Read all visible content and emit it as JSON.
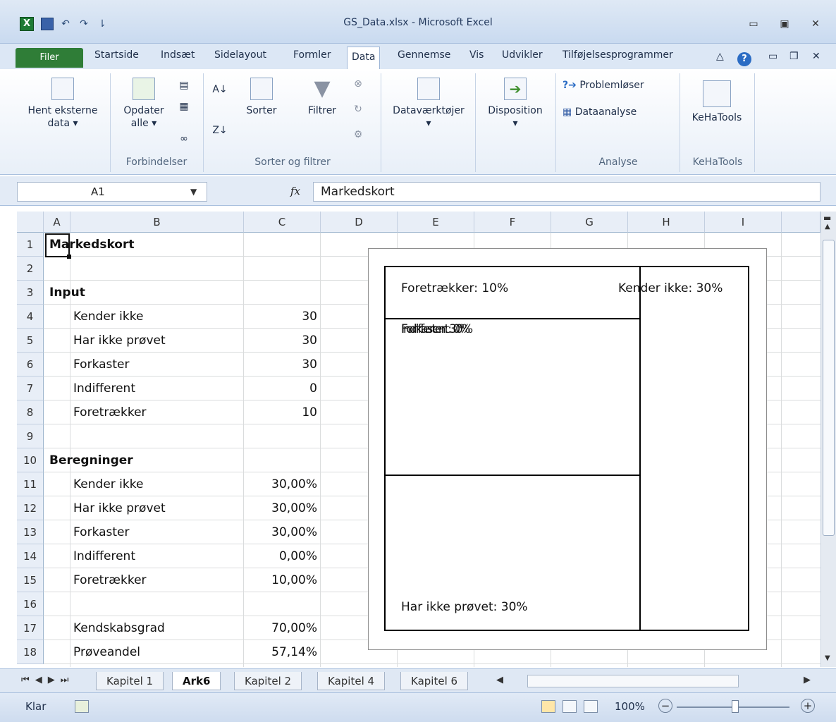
{
  "window": {
    "title": "GS_Data.xlsx - Microsoft Excel",
    "app_icon": "X",
    "qat_icons": [
      "save-icon",
      "undo-icon",
      "redo-icon",
      "customize-icon"
    ]
  },
  "ribbon_tabs": [
    {
      "label": "Filer"
    },
    {
      "label": "Startside"
    },
    {
      "label": "Indsæt"
    },
    {
      "label": "Sidelayout"
    },
    {
      "label": "Formler"
    },
    {
      "label": "Data"
    },
    {
      "label": "Gennemse"
    },
    {
      "label": "Vis"
    },
    {
      "label": "Udvikler"
    },
    {
      "label": "Tilføjelsesprogrammer"
    }
  ],
  "ribbon": {
    "get_external": {
      "line1": "Hent eksterne",
      "line2": "data ▾"
    },
    "refresh": {
      "line1": "Opdater",
      "line2": "alle ▾"
    },
    "sort": "Sorter",
    "filter": "Filtrer",
    "data_tools": "Dataværktøjer",
    "outline": "Disposition",
    "solver": "Problemløser",
    "data_analysis": "Dataanalyse",
    "kehatools": "KeHaTools",
    "groups": {
      "connections": "Forbindelser",
      "sort_filter": "Sorter og filtrer",
      "analysis": "Analyse",
      "kehatools": "KeHaTools"
    }
  },
  "formula_bar": {
    "name_box": "A1",
    "fx": "fx",
    "formula": "Markedskort"
  },
  "columns": [
    "A",
    "B",
    "C",
    "D",
    "E",
    "F",
    "G",
    "H",
    "I"
  ],
  "rows": [
    "1",
    "2",
    "3",
    "4",
    "5",
    "6",
    "7",
    "8",
    "9",
    "10",
    "11",
    "12",
    "13",
    "14",
    "15",
    "16",
    "17",
    "18"
  ],
  "cells": {
    "r1": {
      "label": "Markedskort"
    },
    "r3": {
      "label": "Input"
    },
    "r4": {
      "label": "Kender ikke",
      "value": "30"
    },
    "r5": {
      "label": "Har ikke prøvet",
      "value": "30"
    },
    "r6": {
      "label": "Forkaster",
      "value": "30"
    },
    "r7": {
      "label": "Indifferent",
      "value": "0"
    },
    "r8": {
      "label": "Foretrækker",
      "value": "10"
    },
    "r10": {
      "label": "Beregninger"
    },
    "r11": {
      "label": "Kender ikke",
      "value": "30,00%"
    },
    "r12": {
      "label": "Har ikke prøvet",
      "value": "30,00%"
    },
    "r13": {
      "label": "Forkaster",
      "value": "30,00%"
    },
    "r14": {
      "label": "Indifferent",
      "value": "0,00%"
    },
    "r15": {
      "label": "Foretrækker",
      "value": "10,00%"
    },
    "r17": {
      "label": "Kendskabsgrad",
      "value": "70,00%"
    },
    "r18": {
      "label": "Prøveandel",
      "value": "57,14%"
    }
  },
  "chart": {
    "foretraekker": "Foretrækker: 10%",
    "kender_ikke": "Kender ikke: 30%",
    "forkaster": "Forkaster: 30%",
    "indifferent": "Indifferent: 0%",
    "har_ikke_proevet": "Har ikke prøvet: 30%"
  },
  "sheet_tabs": [
    "Kapitel 1",
    "Ark6",
    "Kapitel 2",
    "Kapitel 4",
    "Kapitel 6"
  ],
  "status_bar": {
    "status": "Klar",
    "zoom": "100%",
    "zoom_out": "−",
    "zoom_in": "+"
  }
}
